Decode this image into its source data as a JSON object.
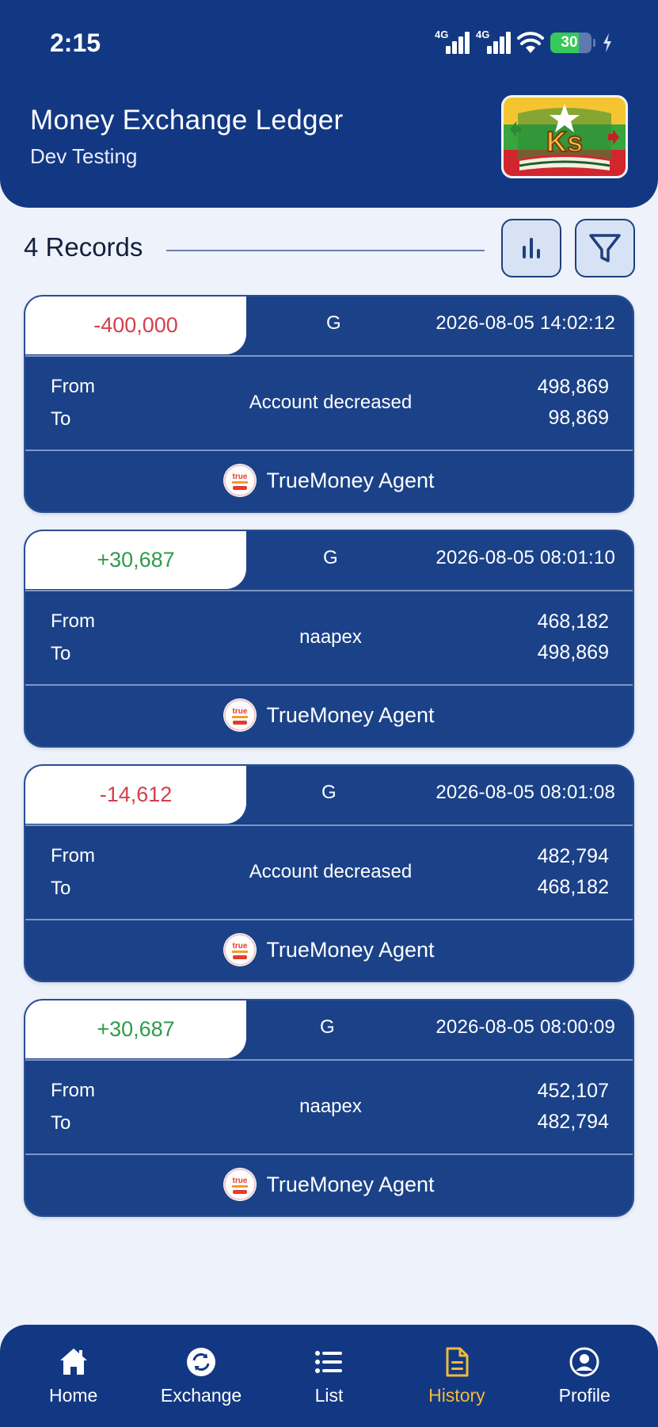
{
  "status_bar": {
    "time": "2:15",
    "network_label_1": "4G",
    "network_label_2": "4G",
    "battery": "30"
  },
  "header": {
    "title": "Money Exchange Ledger",
    "subtitle": "Dev Testing",
    "logo_text": "Ks"
  },
  "records": {
    "count_label": "4 Records"
  },
  "cards": [
    {
      "amount": "-400,000",
      "sign": "negative",
      "currency": "G",
      "timestamp": "2026-08-05 14:02:12",
      "from_label": "From",
      "to_label": "To",
      "description": "Account decreased",
      "from_value": "498,869",
      "to_value": "98,869",
      "agent": "TrueMoney Agent"
    },
    {
      "amount": "+30,687",
      "sign": "positive",
      "currency": "G",
      "timestamp": "2026-08-05 08:01:10",
      "from_label": "From",
      "to_label": "To",
      "description": "naapex",
      "from_value": "468,182",
      "to_value": "498,869",
      "agent": "TrueMoney Agent"
    },
    {
      "amount": "-14,612",
      "sign": "negative",
      "currency": "G",
      "timestamp": "2026-08-05 08:01:08",
      "from_label": "From",
      "to_label": "To",
      "description": "Account decreased",
      "from_value": "482,794",
      "to_value": "468,182",
      "agent": "TrueMoney Agent"
    },
    {
      "amount": "+30,687",
      "sign": "positive",
      "currency": "G",
      "timestamp": "2026-08-05 08:00:09",
      "from_label": "From",
      "to_label": "To",
      "description": "naapex",
      "from_value": "452,107",
      "to_value": "482,794",
      "agent": "TrueMoney Agent"
    }
  ],
  "agent_logo_text": "true",
  "nav": {
    "home": "Home",
    "exchange": "Exchange",
    "list": "List",
    "history": "History",
    "profile": "Profile",
    "active": "history"
  },
  "colors": {
    "primary": "#133883",
    "card": "#1b4288",
    "negative": "#d33f4c",
    "positive": "#2f9b4a",
    "active_nav": "#f2b93b",
    "background": "#eef2fa"
  }
}
